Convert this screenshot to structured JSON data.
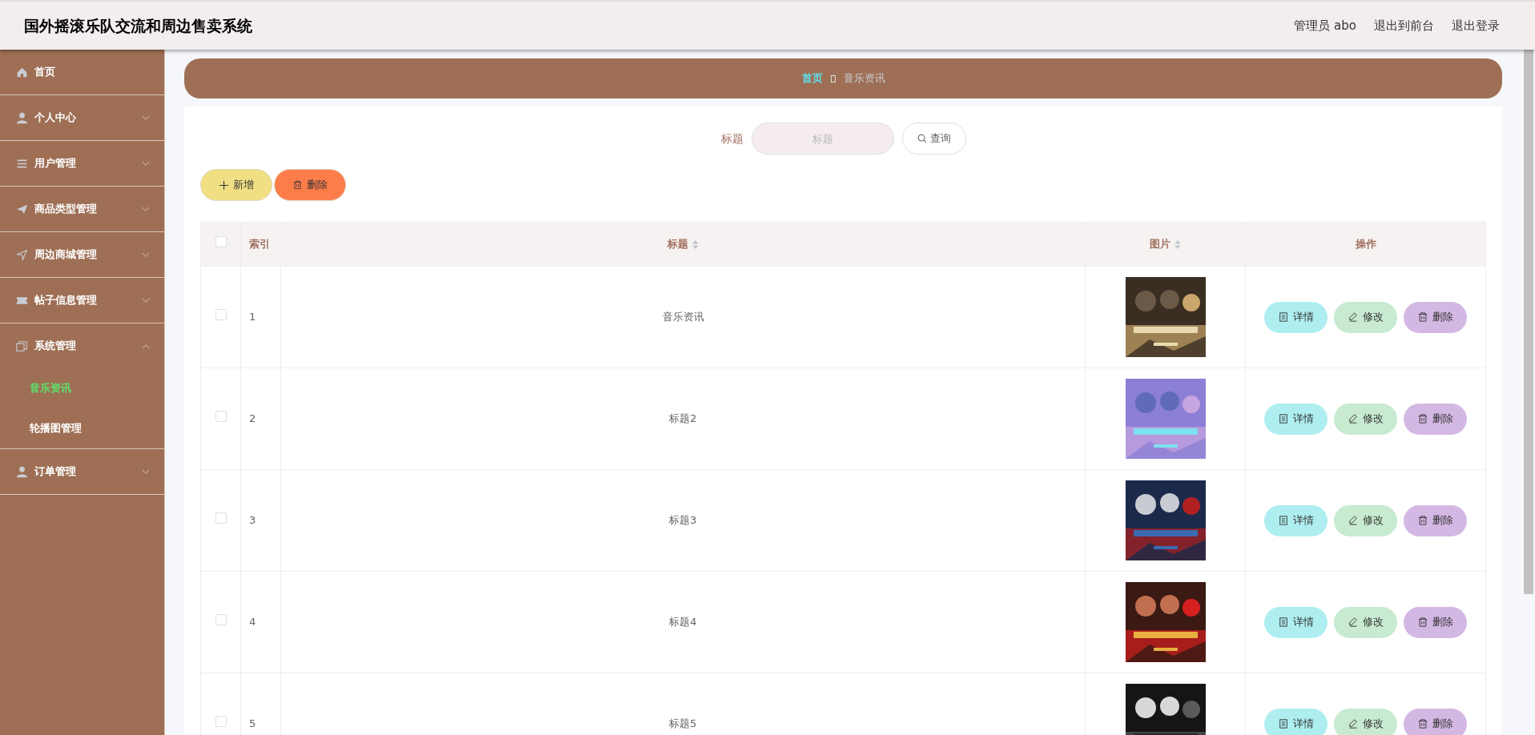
{
  "header": {
    "title": "国外摇滚乐队交流和周边售卖系统",
    "links": [
      "管理员 abo",
      "退出到前台",
      "退出登录"
    ]
  },
  "sidebar": {
    "items": [
      {
        "label": "首页"
      },
      {
        "label": "个人中心",
        "expanded": false
      },
      {
        "label": "用户管理",
        "expanded": false
      },
      {
        "label": "商品类型管理",
        "expanded": false
      },
      {
        "label": "周边商城管理",
        "expanded": false
      },
      {
        "label": "帖子信息管理",
        "expanded": false
      },
      {
        "label": "系统管理",
        "expanded": true,
        "children": [
          {
            "label": "音乐资讯",
            "selected": true
          },
          {
            "label": "轮播图管理",
            "selected": false
          }
        ]
      },
      {
        "label": "订单管理",
        "expanded": false
      }
    ]
  },
  "breadcrumb": [
    {
      "label": "首页",
      "current": false
    },
    {
      "label": "音乐资讯",
      "current": true
    }
  ],
  "search": {
    "label": "标题",
    "placeholder": "标题",
    "button": "查询"
  },
  "toolbar": [
    {
      "label": "新增",
      "kind": "add"
    },
    {
      "label": "删除",
      "kind": "delete"
    }
  ],
  "table": {
    "select_all_checked": false,
    "columns": [
      {
        "label": "索引",
        "sortable": false
      },
      {
        "label": "标题",
        "sortable": true
      },
      {
        "label": "图片",
        "sortable": true
      },
      {
        "label": "操作",
        "sortable": false
      }
    ],
    "rows": [
      {
        "checked": false,
        "index": "1",
        "title": "音乐资讯",
        "image": {
          "kind": "picture"
        },
        "actions": [
          {
            "label": "详情",
            "kind": "detail"
          },
          {
            "label": "修改",
            "kind": "edit"
          },
          {
            "label": "删除",
            "kind": "delete"
          }
        ]
      },
      {
        "checked": false,
        "index": "2",
        "title": "标题2",
        "image": {
          "kind": "picture"
        },
        "actions": [
          {
            "label": "详情",
            "kind": "detail"
          },
          {
            "label": "修改",
            "kind": "edit"
          },
          {
            "label": "删除",
            "kind": "delete"
          }
        ]
      },
      {
        "checked": false,
        "index": "3",
        "title": "标题3",
        "image": {
          "kind": "picture"
        },
        "actions": [
          {
            "label": "详情",
            "kind": "detail"
          },
          {
            "label": "修改",
            "kind": "edit"
          },
          {
            "label": "删除",
            "kind": "delete"
          }
        ]
      },
      {
        "checked": false,
        "index": "4",
        "title": "标题4",
        "image": {
          "kind": "picture"
        },
        "actions": [
          {
            "label": "详情",
            "kind": "detail"
          },
          {
            "label": "修改",
            "kind": "edit"
          },
          {
            "label": "删除",
            "kind": "delete"
          }
        ]
      },
      {
        "checked": false,
        "index": "5",
        "title": "标题5",
        "image": {
          "kind": "picture"
        },
        "actions": [
          {
            "label": "详情",
            "kind": "detail"
          },
          {
            "label": "修改",
            "kind": "edit"
          },
          {
            "label": "删除",
            "kind": "delete"
          }
        ]
      }
    ]
  }
}
